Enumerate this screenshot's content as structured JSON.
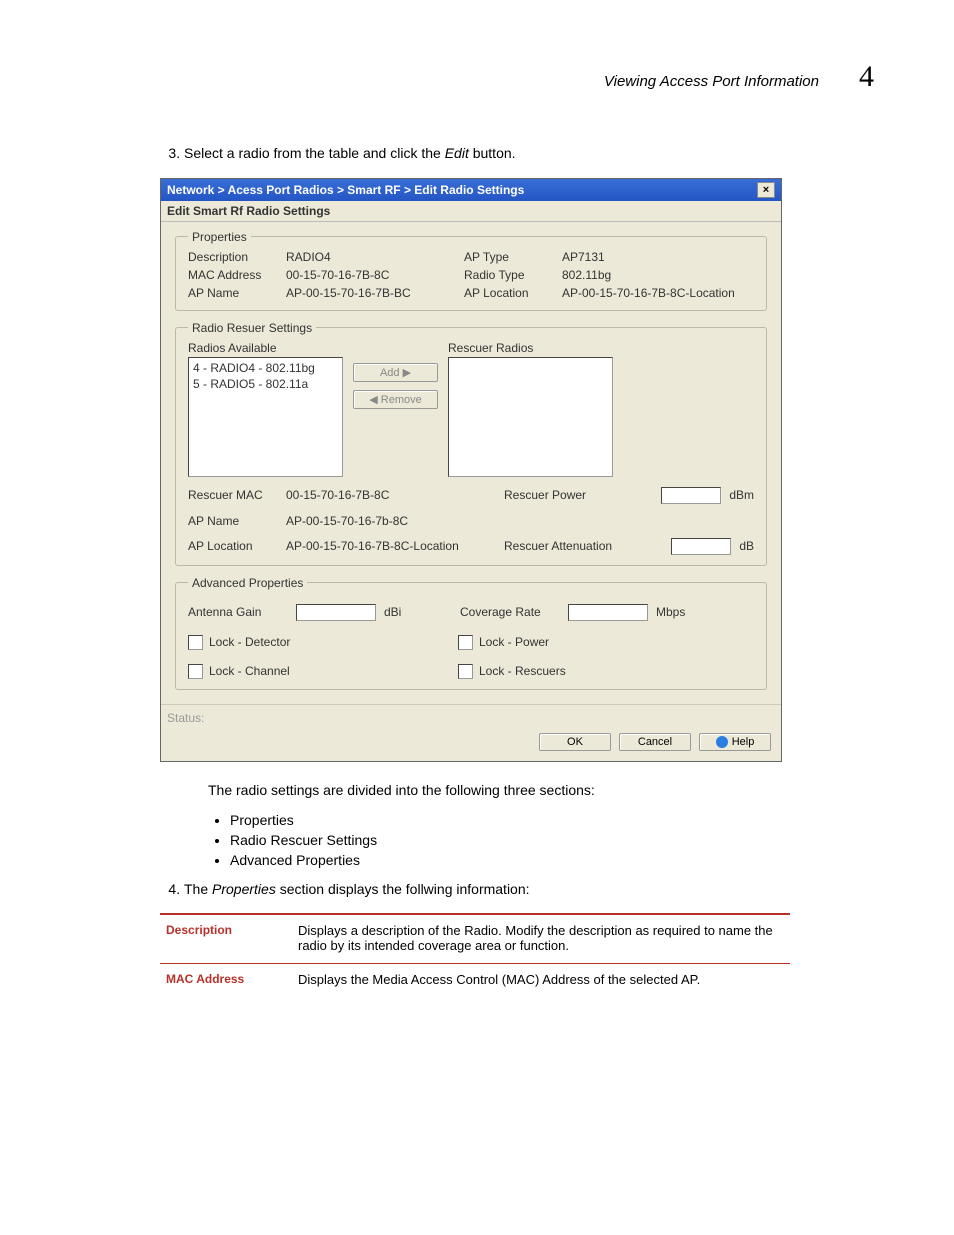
{
  "header": {
    "title": "Viewing Access Port Information",
    "chapter_number": "4"
  },
  "steps": {
    "s3_pre": "Select a radio from the table and click the ",
    "s3_em": "Edit",
    "s3_post": " button.",
    "after_dialog": "The radio settings are divided into the following three sections:",
    "bullets": [
      "Properties",
      "Radio Rescuer Settings",
      "Advanced Properties"
    ],
    "s4_pre": "The ",
    "s4_em": "Properties",
    "s4_post": " section displays the follwing information:"
  },
  "dialog": {
    "title": "Network > Acess Port Radios > Smart RF > Edit Radio Settings",
    "subheader": "Edit  Smart Rf Radio Settings",
    "properties": {
      "legend": "Properties",
      "rows": {
        "l1": "Description",
        "v1": "RADIO4",
        "l1b": "AP Type",
        "v1b": "AP7131",
        "l2": "MAC Address",
        "v2": "00-15-70-16-7B-8C",
        "l2b": "Radio Type",
        "v2b": "802.11bg",
        "l3": "AP Name",
        "v3": "AP-00-15-70-16-7B-BC",
        "l3b": "AP Location",
        "v3b": "AP-00-15-70-16-7B-8C-Location"
      }
    },
    "rescuer": {
      "legend": "Radio Resuer Settings",
      "avail_label": "Radios Available",
      "resc_label": "Rescuer Radios",
      "avail_items": [
        "4 - RADIO4 - 802.11bg",
        "5 - RADIO5 - 802.11a"
      ],
      "add": "Add ▶",
      "remove": "◀ Remove",
      "mac_lbl": "Rescuer MAC",
      "mac_val": "00-15-70-16-7B-8C",
      "pow_lbl": "Rescuer Power",
      "pow_unit": "dBm",
      "apname_lbl": "AP Name",
      "apname_val": "AP-00-15-70-16-7b-8C",
      "aploc_lbl": "AP Location",
      "aploc_val": "AP-00-15-70-16-7B-8C-Location",
      "att_lbl": "Rescuer Attenuation",
      "att_unit": "dB"
    },
    "advanced": {
      "legend": "Advanced Properties",
      "ant_lbl": "Antenna Gain",
      "ant_unit": "dBi",
      "cov_lbl": "Coverage Rate",
      "cov_unit": "Mbps",
      "chk1": "Lock - Detector",
      "chk2": "Lock - Power",
      "chk3": "Lock - Channel",
      "chk4": "Lock - Rescuers"
    },
    "status_label": "Status:",
    "buttons": {
      "ok": "OK",
      "cancel": "Cancel",
      "help": "Help"
    }
  },
  "proptable": {
    "r1k": "Description",
    "r1v": "Displays a description of the Radio. Modify the description as required to name the radio by its intended coverage area or function.",
    "r2k": "MAC Address",
    "r2v": "Displays the Media Access Control (MAC) Address of the selected AP."
  }
}
